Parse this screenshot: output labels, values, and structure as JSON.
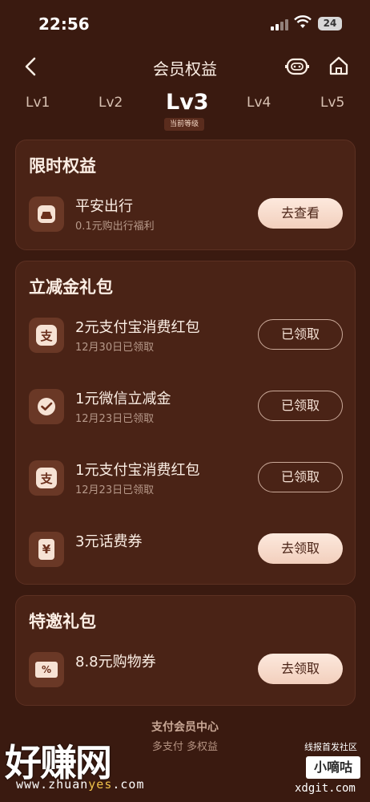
{
  "status_bar": {
    "time": "22:56",
    "battery": "24"
  },
  "nav": {
    "title": "会员权益"
  },
  "levels": {
    "items": [
      "Lv1",
      "Lv2",
      "Lv3",
      "Lv4",
      "Lv5"
    ],
    "current_badge": "当前等级"
  },
  "limited": {
    "title": "限时权益",
    "item": {
      "name": "平安出行",
      "desc": "0.1元购出行福利",
      "button": "去查看"
    }
  },
  "coupons": {
    "title": "立减金礼包",
    "items": [
      {
        "name": "2元支付宝消费红包",
        "desc": "12月30日已领取",
        "button": "已领取",
        "icon": "支"
      },
      {
        "name": "1元微信立减金",
        "desc": "12月23日已领取",
        "button": "已领取",
        "icon": "wechat"
      },
      {
        "name": "1元支付宝消费红包",
        "desc": "12月23日已领取",
        "button": "已领取",
        "icon": "支"
      },
      {
        "name": "3元话费券",
        "desc": "",
        "button": "去领取",
        "icon": "¥"
      }
    ]
  },
  "special": {
    "title": "特邀礼包",
    "item": {
      "name": "8.8元购物券",
      "button": "去领取",
      "icon": "%"
    }
  },
  "footer": {
    "line1": "支付会员中心",
    "line2": "多支付 多权益"
  },
  "watermark": {
    "big": "好赚网",
    "url_a": "www.zhuan",
    "url_b": "yes",
    "url_c": ".com",
    "tag": "线报首发社区",
    "box": "小嘀咕",
    "url2": "xdgit.com"
  },
  "colors": {
    "background": "#3a1a10",
    "card": "#4a2316",
    "button_solid": "#f6dccd",
    "accent_text": "#fbeee4"
  }
}
